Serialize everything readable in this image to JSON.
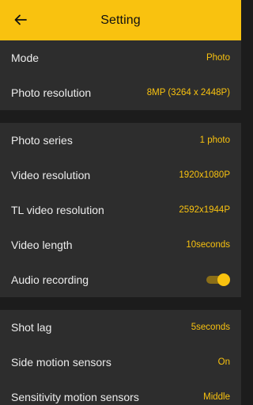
{
  "header": {
    "title": "Setting",
    "back_icon": "arrow-left-icon"
  },
  "colors": {
    "accent": "#f9c20f",
    "background": "#1c1c1c",
    "panel": "#2d2d2d",
    "text": "#ececec"
  },
  "groups": [
    {
      "items": [
        {
          "label": "Mode",
          "value": "Photo"
        },
        {
          "label": "Photo resolution",
          "value": "8MP (3264 x 2448P)"
        }
      ]
    },
    {
      "items": [
        {
          "label": "Photo series",
          "value": "1 photo"
        },
        {
          "label": "Video resolution",
          "value": "1920x1080P"
        },
        {
          "label": "TL video resolution",
          "value": "2592x1944P"
        },
        {
          "label": "Video length",
          "value": "10seconds"
        },
        {
          "label": "Audio recording",
          "toggle": true
        }
      ]
    },
    {
      "items": [
        {
          "label": "Shot lag",
          "value": "5seconds"
        },
        {
          "label": "Side motion sensors",
          "value": "On"
        },
        {
          "label": "Sensitivity motion sensors",
          "value": "Middle"
        }
      ]
    }
  ]
}
